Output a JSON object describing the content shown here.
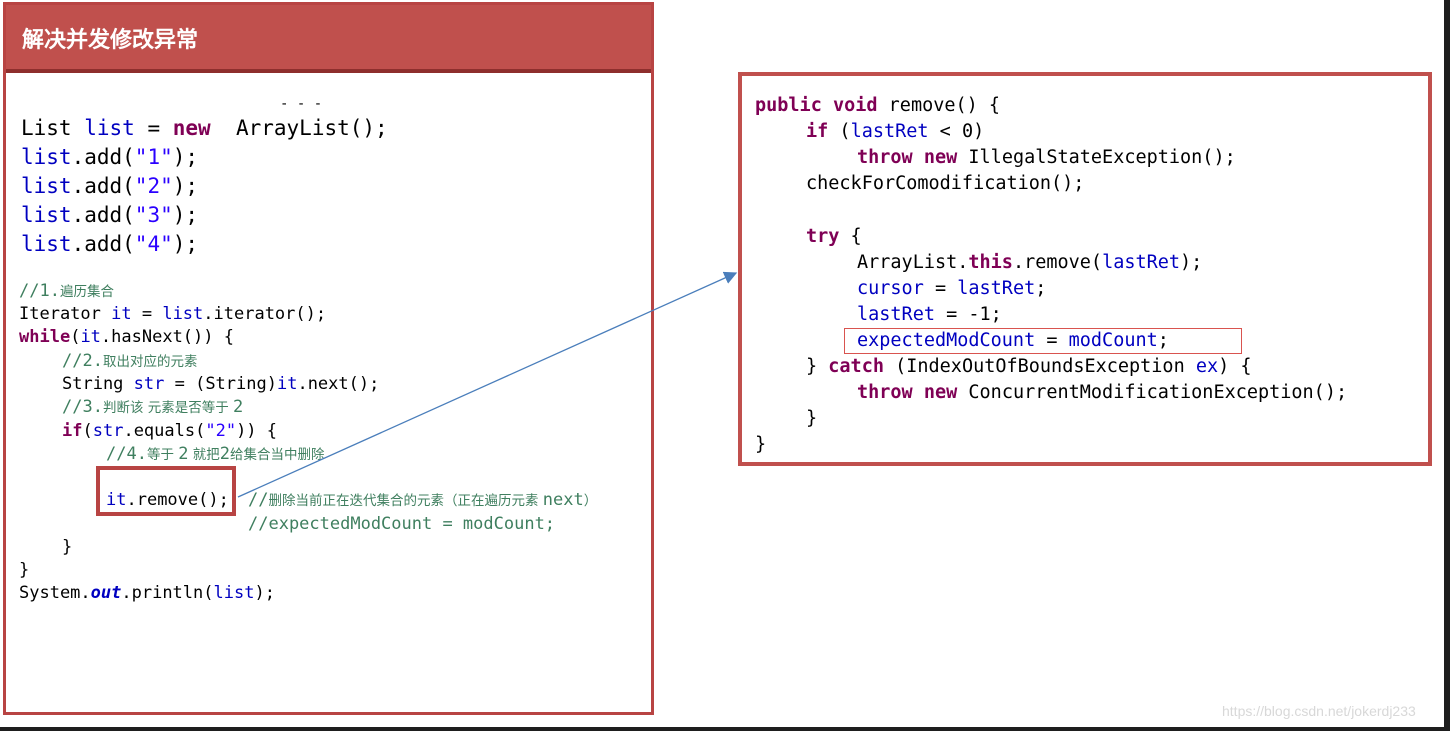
{
  "title": "解决并发修改异常",
  "left_code": {
    "line1": [
      "List ",
      "list",
      " = ",
      "new",
      "  ArrayList();"
    ],
    "add_lines": [
      {
        "pre": "list",
        "mid": ".add(",
        "str": "\"1\"",
        "post": ");"
      },
      {
        "pre": "list",
        "mid": ".add(",
        "str": "\"2\"",
        "post": ");"
      },
      {
        "pre": "list",
        "mid": ".add(",
        "str": "\"3\"",
        "post": ");"
      },
      {
        "pre": "list",
        "mid": ".add(",
        "str": "\"4\"",
        "post": ");"
      }
    ],
    "comment1": {
      "prefix": "//1.",
      "text": "遍历集合"
    },
    "iterator_line": {
      "type": "Iterator ",
      "var": "it",
      "eq": " = ",
      "list": "list",
      "rest": ".iterator();"
    },
    "while_line": {
      "kw": "while",
      "open": "(",
      "var": "it",
      "rest": ".hasNext()) {"
    },
    "comment2": {
      "prefix": "//2.",
      "text": "取出对应的元素"
    },
    "string_line": {
      "type": "String ",
      "var": "str",
      "eq": " = (String)",
      "it": "it",
      "rest": ".next();"
    },
    "comment3": {
      "prefix": "//3.",
      "text": "判断该 元素是否等于 ",
      "tail": "2"
    },
    "if_line": {
      "kw": "if",
      "open": "(",
      "var": "str",
      "mid": ".equals(",
      "str": "\"2\"",
      "close": ")) {"
    },
    "comment4": {
      "prefix": "//4.",
      "text": "等于 ",
      "two": "2",
      "text2": " 就把",
      "two2": "2",
      "text3": "给集合当中删除"
    },
    "remove_line": {
      "var": "it",
      "rest": ".remove();"
    },
    "remove_comment": {
      "prefix": "//",
      "text": "删除当前正在迭代集合的元素（正在遍历元素 ",
      "next": "next",
      "close": "）"
    },
    "expected_comment": "//expectedModCount = modCount;",
    "close_brace_inner": "}",
    "close_brace_outer": "}",
    "print_line": {
      "pre": "System.",
      "out": "out",
      "post": ".println(",
      "var": "list",
      "end": ");"
    }
  },
  "right_code": {
    "l1": {
      "kw1": "public",
      "kw2": "void",
      "rest": " remove() {"
    },
    "l2": {
      "kw": "if",
      "open": " (",
      "var": "lastRet",
      "rest": " < 0)"
    },
    "l3": {
      "kw1": "throw",
      "kw2": "new",
      "rest": " IllegalStateException();"
    },
    "l4": "checkForComodification();",
    "l5": {
      "kw": "try",
      "rest": " {"
    },
    "l6": {
      "pre": "ArrayList.",
      "kw": "this",
      "mid": ".remove(",
      "var": "lastRet",
      "end": ");"
    },
    "l7": {
      "var1": "cursor",
      "eq": " = ",
      "var2": "lastRet",
      "end": ";"
    },
    "l8": {
      "var": "lastRet",
      "rest": " = -1;"
    },
    "l9": {
      "var1": "expectedModCount",
      "eq": " = ",
      "var2": "modCount",
      "end": ";"
    },
    "l10": {
      "pre": "} ",
      "kw": "catch",
      "mid": " (IndexOutOfBoundsException ",
      "var": "ex",
      "end": ") {"
    },
    "l11": {
      "kw1": "throw",
      "kw2": "new",
      "rest": " ConcurrentModificationException();"
    },
    "l12": "}",
    "l13": "}"
  },
  "watermark": "https://blog.csdn.net/jokerdj233",
  "colors": {
    "title_bg": "#c0504d",
    "border": "#b84443",
    "keyword": "#7f0055",
    "variable": "#0000c0",
    "string": "#2a00ff",
    "comment": "#3f7f5f",
    "arrow": "#4a7ebb"
  }
}
